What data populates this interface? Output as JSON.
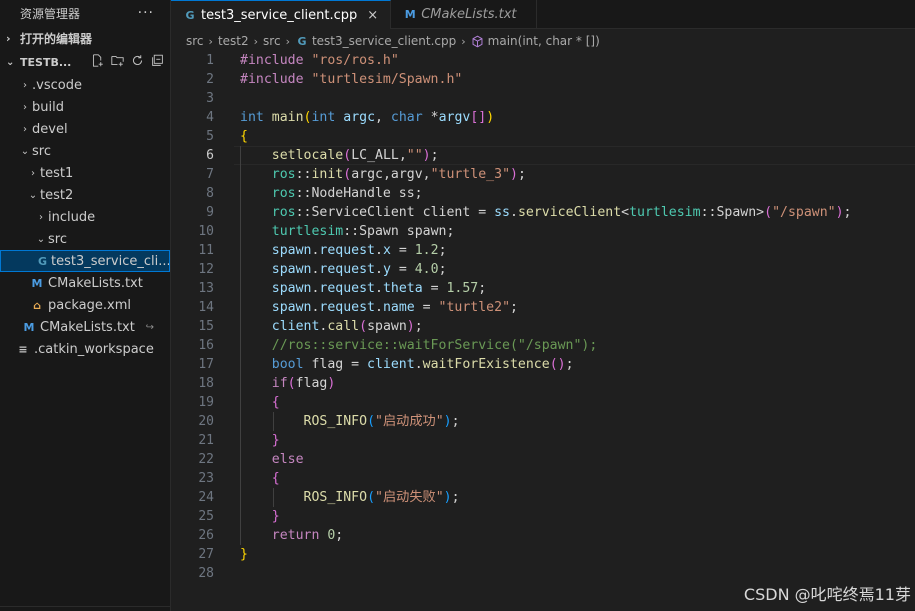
{
  "sidebar": {
    "title": "资源管理器",
    "menu_glyph": "···",
    "open_editors": "打开的编辑器",
    "project": "TESTB...",
    "tree": [
      {
        "label": ".vscode",
        "type": "folder"
      },
      {
        "label": "build",
        "type": "folder"
      },
      {
        "label": "devel",
        "type": "folder"
      },
      {
        "label": "src",
        "type": "folder-open"
      },
      {
        "label": "test1",
        "type": "folder"
      },
      {
        "label": "test2",
        "type": "folder-open"
      },
      {
        "label": "include",
        "type": "folder"
      },
      {
        "label": "src",
        "type": "folder-open"
      },
      {
        "label": "test3_service_cli...",
        "type": "cpp"
      },
      {
        "label": "CMakeLists.txt",
        "type": "cmake"
      },
      {
        "label": "package.xml",
        "type": "xml"
      },
      {
        "label": "CMakeLists.txt",
        "type": "cmake"
      },
      {
        "label": ".catkin_workspace",
        "type": "text"
      }
    ]
  },
  "tabs": [
    {
      "label": "test3_service_client.cpp",
      "active": true,
      "close": "×"
    },
    {
      "label": "CMakeLists.txt",
      "active": false
    }
  ],
  "breadcrumbs": [
    "src",
    "test2",
    "src",
    "test3_service_client.cpp",
    "main(int, char * [])"
  ],
  "editor": {
    "cursor_line": 6,
    "lines": [
      [
        [
          "t-ctl",
          "#include "
        ],
        [
          "t-str",
          "\"ros/ros.h\""
        ]
      ],
      [
        [
          "t-ctl",
          "#include "
        ],
        [
          "t-str",
          "\"turtlesim/Spawn.h\""
        ]
      ],
      [],
      [
        [
          "t-kw",
          "int "
        ],
        [
          "t-fn",
          "main"
        ],
        [
          "t-br1",
          "("
        ],
        [
          "t-kw",
          "int "
        ],
        [
          "t-var",
          "argc"
        ],
        [
          "t-op",
          ", "
        ],
        [
          "t-kw",
          "char "
        ],
        [
          "t-op",
          "*"
        ],
        [
          "t-var",
          "argv"
        ],
        [
          "t-br2",
          "[]"
        ],
        [
          "t-br1",
          ")"
        ]
      ],
      [
        [
          "t-br1",
          "{"
        ]
      ],
      [
        [
          "t-op",
          "    "
        ],
        [
          "t-fn",
          "setlocale"
        ],
        [
          "t-br2",
          "("
        ],
        [
          "t-op",
          "LC_ALL,"
        ],
        [
          "t-str",
          "\"\""
        ],
        [
          "t-br2",
          ")"
        ],
        [
          "t-op",
          ";"
        ]
      ],
      [
        [
          "t-op",
          "    "
        ],
        [
          "t-type",
          "ros"
        ],
        [
          "t-op",
          "::"
        ],
        [
          "t-fn",
          "init"
        ],
        [
          "t-br2",
          "("
        ],
        [
          "t-op",
          "argc,argv,"
        ],
        [
          "t-str",
          "\"turtle_3\""
        ],
        [
          "t-br2",
          ")"
        ],
        [
          "t-op",
          ";"
        ]
      ],
      [
        [
          "t-op",
          "    "
        ],
        [
          "t-type",
          "ros"
        ],
        [
          "t-op",
          "::NodeHandle ss;"
        ]
      ],
      [
        [
          "t-op",
          "    "
        ],
        [
          "t-type",
          "ros"
        ],
        [
          "t-op",
          "::ServiceClient client = "
        ],
        [
          "t-var",
          "ss"
        ],
        [
          "t-op",
          "."
        ],
        [
          "t-fn",
          "serviceClient"
        ],
        [
          "t-op",
          "<"
        ],
        [
          "t-type",
          "turtlesim"
        ],
        [
          "t-op",
          "::Spawn>"
        ],
        [
          "t-br2",
          "("
        ],
        [
          "t-str",
          "\"/spawn\""
        ],
        [
          "t-br2",
          ")"
        ],
        [
          "t-op",
          ";"
        ]
      ],
      [
        [
          "t-op",
          "    "
        ],
        [
          "t-type",
          "turtlesim"
        ],
        [
          "t-op",
          "::Spawn spawn;"
        ]
      ],
      [
        [
          "t-op",
          "    "
        ],
        [
          "t-var",
          "spawn"
        ],
        [
          "t-op",
          "."
        ],
        [
          "t-var",
          "request"
        ],
        [
          "t-op",
          "."
        ],
        [
          "t-var",
          "x"
        ],
        [
          "t-op",
          " = "
        ],
        [
          "t-num",
          "1.2"
        ],
        [
          "t-op",
          ";"
        ]
      ],
      [
        [
          "t-op",
          "    "
        ],
        [
          "t-var",
          "spawn"
        ],
        [
          "t-op",
          "."
        ],
        [
          "t-var",
          "request"
        ],
        [
          "t-op",
          "."
        ],
        [
          "t-var",
          "y"
        ],
        [
          "t-op",
          " = "
        ],
        [
          "t-num",
          "4.0"
        ],
        [
          "t-op",
          ";"
        ]
      ],
      [
        [
          "t-op",
          "    "
        ],
        [
          "t-var",
          "spawn"
        ],
        [
          "t-op",
          "."
        ],
        [
          "t-var",
          "request"
        ],
        [
          "t-op",
          "."
        ],
        [
          "t-var",
          "theta"
        ],
        [
          "t-op",
          " = "
        ],
        [
          "t-num",
          "1.57"
        ],
        [
          "t-op",
          ";"
        ]
      ],
      [
        [
          "t-op",
          "    "
        ],
        [
          "t-var",
          "spawn"
        ],
        [
          "t-op",
          "."
        ],
        [
          "t-var",
          "request"
        ],
        [
          "t-op",
          "."
        ],
        [
          "t-var",
          "name"
        ],
        [
          "t-op",
          " = "
        ],
        [
          "t-str",
          "\"turtle2\""
        ],
        [
          "t-op",
          ";"
        ]
      ],
      [
        [
          "t-op",
          "    "
        ],
        [
          "t-var",
          "client"
        ],
        [
          "t-op",
          "."
        ],
        [
          "t-fn",
          "call"
        ],
        [
          "t-br2",
          "("
        ],
        [
          "t-op",
          "spawn"
        ],
        [
          "t-br2",
          ")"
        ],
        [
          "t-op",
          ";"
        ]
      ],
      [
        [
          "t-op",
          "    "
        ],
        [
          "t-com",
          "//ros::service::waitForService(\"/spawn\");"
        ]
      ],
      [
        [
          "t-op",
          "    "
        ],
        [
          "t-kw",
          "bool "
        ],
        [
          "t-op",
          "flag = "
        ],
        [
          "t-var",
          "client"
        ],
        [
          "t-op",
          "."
        ],
        [
          "t-fn",
          "waitForExistence"
        ],
        [
          "t-br2",
          "()"
        ],
        [
          "t-op",
          ";"
        ]
      ],
      [
        [
          "t-op",
          "    "
        ],
        [
          "t-ctl",
          "if"
        ],
        [
          "t-br2",
          "("
        ],
        [
          "t-op",
          "flag"
        ],
        [
          "t-br2",
          ")"
        ]
      ],
      [
        [
          "t-op",
          "    "
        ],
        [
          "t-br2",
          "{"
        ]
      ],
      [
        [
          "t-op",
          "        "
        ],
        [
          "t-fn",
          "ROS_INFO"
        ],
        [
          "t-br3",
          "("
        ],
        [
          "t-str",
          "\"启动成功\""
        ],
        [
          "t-br3",
          ")"
        ],
        [
          "t-op",
          ";"
        ]
      ],
      [
        [
          "t-op",
          "    "
        ],
        [
          "t-br2",
          "}"
        ]
      ],
      [
        [
          "t-op",
          "    "
        ],
        [
          "t-ctl",
          "else"
        ]
      ],
      [
        [
          "t-op",
          "    "
        ],
        [
          "t-br2",
          "{"
        ]
      ],
      [
        [
          "t-op",
          "        "
        ],
        [
          "t-fn",
          "ROS_INFO"
        ],
        [
          "t-br3",
          "("
        ],
        [
          "t-str",
          "\"启动失败\""
        ],
        [
          "t-br3",
          ")"
        ],
        [
          "t-op",
          ";"
        ]
      ],
      [
        [
          "t-op",
          "    "
        ],
        [
          "t-br2",
          "}"
        ]
      ],
      [
        [
          "t-op",
          "    "
        ],
        [
          "t-ctl",
          "return "
        ],
        [
          "t-num",
          "0"
        ],
        [
          "t-op",
          ";"
        ]
      ],
      [
        [
          "t-br1",
          "}"
        ]
      ],
      []
    ]
  },
  "watermark": "CSDN @叱咤终焉11芽",
  "colors": {
    "accent": "#0078d4",
    "selection": "#04395e",
    "cmake_icon": "#4b9ce2",
    "xml_icon": "#e8ab53",
    "cpp_icon": "#519aba"
  }
}
